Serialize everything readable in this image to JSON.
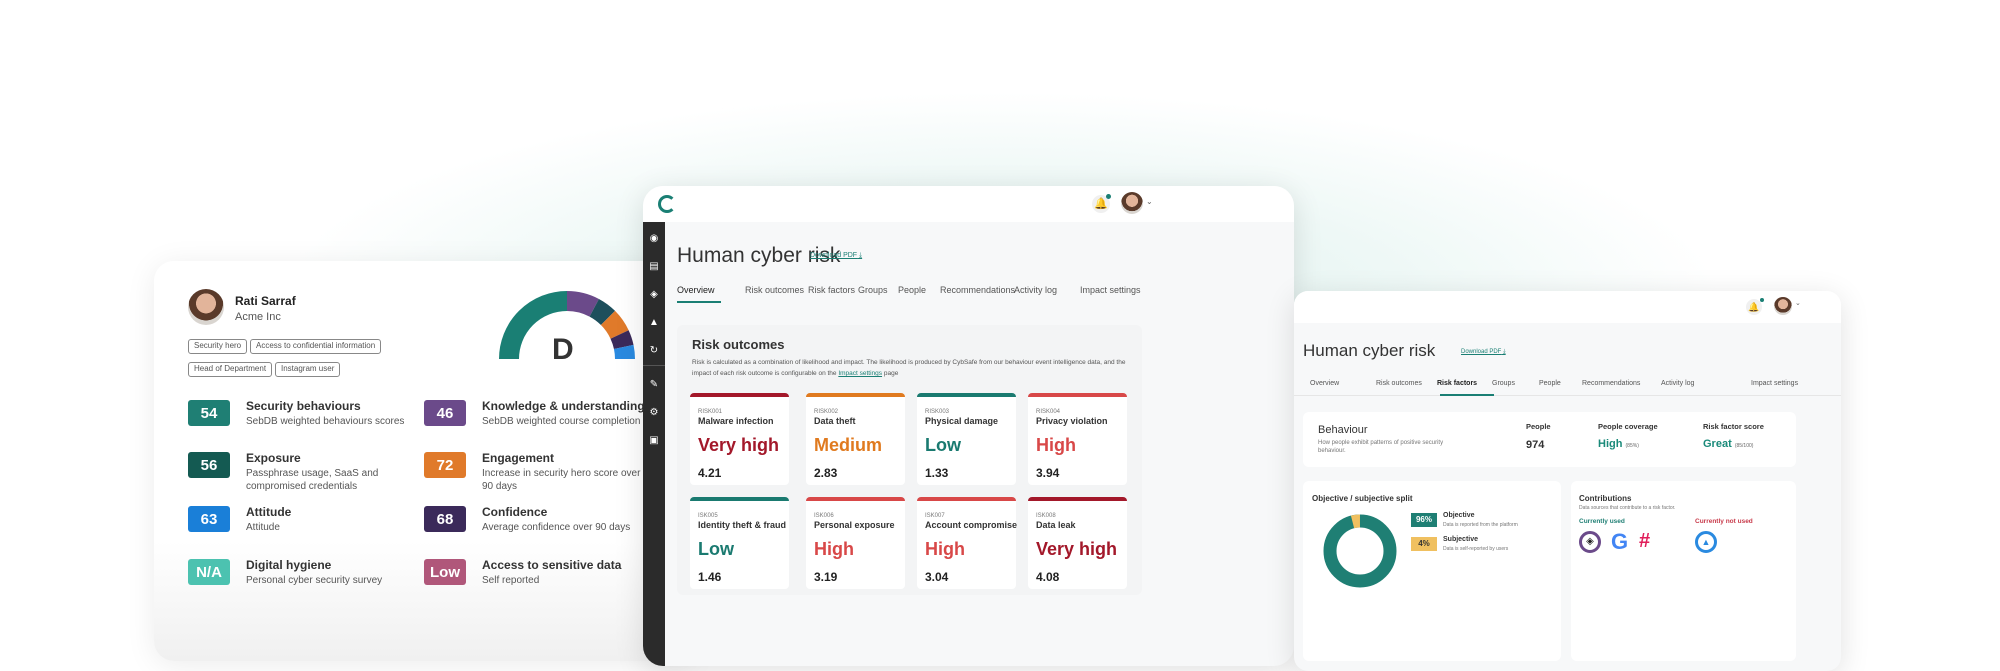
{
  "profile": {
    "name": "Rati Sarraf",
    "company": "Acme Inc",
    "tags": [
      "Security hero",
      "Access to confidential information",
      "Head of Department",
      "Instagram user"
    ],
    "grade": "D",
    "gauge_colors": [
      "#1a7f74",
      "#6b4a8a",
      "#1d4f5c",
      "#e07a2a",
      "#3b2a5a",
      "#2a8ae0"
    ],
    "scores": [
      {
        "value": "54",
        "title": "Security behaviours",
        "desc": "SebDB weighted behaviours scores",
        "color": "#1f7f74"
      },
      {
        "value": "56",
        "title": "Exposure",
        "desc": "Passphrase usage, SaaS and compromised credentials",
        "color": "#145a52"
      },
      {
        "value": "63",
        "title": "Attitude",
        "desc": "Attitude",
        "color": "#1a7fd8"
      },
      {
        "value": "N/A",
        "title": "Digital hygiene",
        "desc": "Personal cyber security survey",
        "color": "#4cc2b0"
      },
      {
        "value": "46",
        "title": "Knowledge & understanding",
        "desc": "SebDB weighted course completion",
        "color": "#6b4a8a"
      },
      {
        "value": "72",
        "title": "Engagement",
        "desc": "Increase in security hero score over 90 days",
        "color": "#e07a2a"
      },
      {
        "value": "68",
        "title": "Confidence",
        "desc": "Average confidence over 90 days",
        "color": "#3b2a5a"
      },
      {
        "value": "Low",
        "title": "Access to sensitive data",
        "desc": "Self reported",
        "color": "#b0577a"
      }
    ]
  },
  "overview": {
    "title": "Human cyber risk",
    "download": "Download PDF",
    "tabs": [
      "Overview",
      "Risk outcomes",
      "Risk factors",
      "Groups",
      "People",
      "Recommendations",
      "Activity log",
      "Impact settings"
    ],
    "active_tab": "Overview",
    "section_title": "Risk outcomes",
    "desc_1": "Risk is calculated as a combination of likelihood and impact. The likelihood is produced by CybSafe from our behaviour event intelligence data, and the impact of each risk outcome is configurable on the ",
    "desc_link": "Impact settings",
    "desc_2": " page",
    "risks": [
      {
        "id": "RISK001",
        "name": "Malware infection",
        "level": "Very high",
        "value": "4.21",
        "color": "#a3182a"
      },
      {
        "id": "RISK002",
        "name": "Data theft",
        "level": "Medium",
        "value": "2.83",
        "color": "#e07a1f"
      },
      {
        "id": "RISK003",
        "name": "Physical damage",
        "level": "Low",
        "value": "1.33",
        "color": "#1a7a70"
      },
      {
        "id": "RISK004",
        "name": "Privacy violation",
        "level": "High",
        "value": "3.94",
        "color": "#d84848"
      },
      {
        "id": "ISK005",
        "name": "Identity theft & fraud",
        "level": "Low",
        "value": "1.46",
        "color": "#1a7a70"
      },
      {
        "id": "ISK006",
        "name": "Personal exposure",
        "level": "High",
        "value": "3.19",
        "color": "#d84848"
      },
      {
        "id": "ISK007",
        "name": "Account compromise",
        "level": "High",
        "value": "3.04",
        "color": "#d84848"
      },
      {
        "id": "ISK008",
        "name": "Data leak",
        "level": "Very high",
        "value": "4.08",
        "color": "#a3182a"
      }
    ]
  },
  "factors": {
    "title": "Human cyber risk",
    "download": "Download PDF",
    "active_tab": "Risk factors",
    "behaviour": {
      "title": "Behaviour",
      "desc": "How people exhibit patterns of positive security behaviour.",
      "people_label": "People",
      "people_value": "974",
      "coverage_label": "People coverage",
      "coverage_value": "High",
      "coverage_detail": "(85%)",
      "score_label": "Risk factor score",
      "score_value": "Great",
      "score_detail": "(85/100)"
    },
    "split": {
      "title": "Objective / subjective split",
      "objective": {
        "pct": 96,
        "label": "96%",
        "name": "Objective",
        "desc": "Data is reported from the platform"
      },
      "subjective": {
        "pct": 4,
        "label": "4%",
        "name": "Subjective",
        "desc": "Data is self-reported by users"
      }
    },
    "contributions": {
      "title": "Contributions",
      "desc": "Data sources that contribute to a risk factor.",
      "used": "Currently used",
      "not_used": "Currently not used"
    }
  },
  "colors": {
    "brand": "#1a7f74",
    "sidebar": "#2b2b2b"
  }
}
